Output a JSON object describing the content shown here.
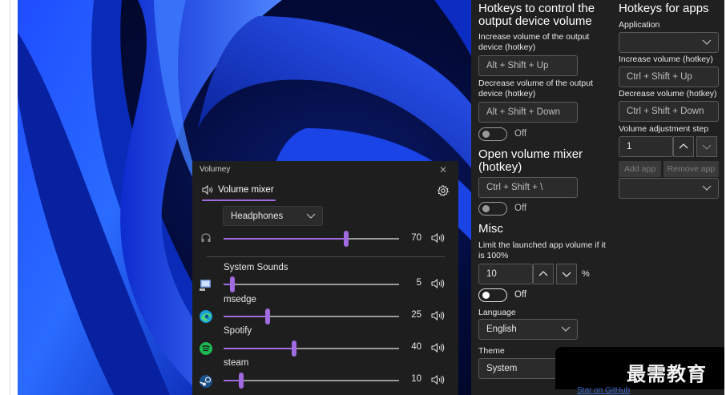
{
  "settings": {
    "output_hotkeys": {
      "title": "Hotkeys to control the output device volume",
      "increase_label": "Increase volume of the output device (hotkey)",
      "increase_value": "Alt + Shift + Up",
      "decrease_label": "Decrease volume of the output device (hotkey)",
      "decrease_value": "Alt + Shift + Down",
      "toggle_label": "Off"
    },
    "mixer_hotkey": {
      "title": "Open volume mixer (hotkey)",
      "value": "Ctrl + Shift + \\",
      "toggle_label": "Off"
    },
    "misc": {
      "title": "Misc",
      "limit_label": "Limit the launched app volume if it is 100%",
      "limit_value": "10",
      "percent": "%",
      "toggle_label": "Off",
      "language_label": "Language",
      "language_value": "English",
      "theme_label": "Theme",
      "theme_value": "System"
    },
    "app_hotkeys": {
      "title": "Hotkeys for apps",
      "application_label": "Application",
      "application_value": "",
      "increase_label": "Increase volume (hotkey)",
      "increase_value": "Ctrl + Shift + Up",
      "decrease_label": "Decrease volume (hotkey)",
      "decrease_value": "Ctrl + Shift + Down",
      "step_label": "Volume adjustment step",
      "step_value": "1",
      "add_app": "Add app",
      "remove_app": "Remove app",
      "app_list_value": ""
    }
  },
  "mixer": {
    "window_title": "Volumey",
    "tab_label": "Volume mixer",
    "device": "Headphones",
    "master": {
      "volume": 70
    },
    "sessions": [
      {
        "name": "System Sounds",
        "volume": 5,
        "icon": "system-sounds-icon"
      },
      {
        "name": "msedge",
        "volume": 25,
        "icon": "edge-icon"
      },
      {
        "name": "Spotify",
        "volume": 40,
        "icon": "spotify-icon"
      },
      {
        "name": "steam",
        "volume": 10,
        "icon": "steam-icon"
      }
    ],
    "accent": "#a06be0"
  },
  "watermark": {
    "text": "最需教育",
    "link": "Star on GitHub"
  }
}
